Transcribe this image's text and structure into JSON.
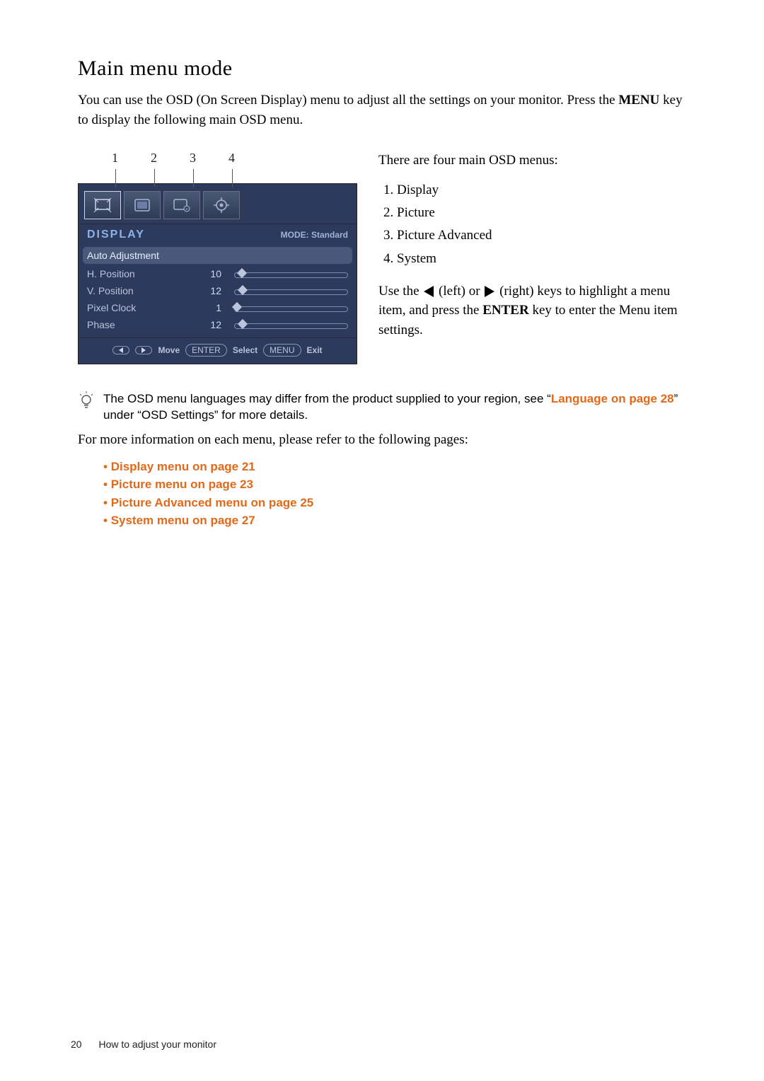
{
  "heading": "Main menu mode",
  "intro_a": "You can use the OSD (On Screen Display) menu to adjust all the settings on your monitor. Press the ",
  "intro_key": "MENU",
  "intro_b": " key to display the following main OSD menu.",
  "osd": {
    "tab_numbers": [
      "1",
      "2",
      "3",
      "4"
    ],
    "title": "DISPLAY",
    "mode_label": "MODE: Standard",
    "rows": [
      {
        "label": "Auto Adjustment",
        "value": "",
        "pct": null,
        "selected": true
      },
      {
        "label": "H. Position",
        "value": "10",
        "pct": 10,
        "selected": false
      },
      {
        "label": "V. Position",
        "value": "12",
        "pct": 12,
        "selected": false
      },
      {
        "label": "Pixel Clock",
        "value": "1",
        "pct": 1,
        "selected": false
      },
      {
        "label": "Phase",
        "value": "12",
        "pct": 12,
        "selected": false
      }
    ],
    "footer": {
      "move": "Move",
      "select": "Select",
      "enter": "ENTER",
      "menu": "MENU",
      "exit": "Exit"
    }
  },
  "right": {
    "intro": "There are four main OSD menus:",
    "menus": [
      "Display",
      "Picture",
      "Picture Advanced",
      "System"
    ],
    "use_a": "Use the ",
    "left_hint": " (left) or ",
    "right_hint": " (right) keys to high­light a menu item, and press the ",
    "enter_key": "ENTER",
    "use_b": " key to enter the Menu item settings."
  },
  "tip": {
    "text_a": "The OSD menu languages may differ from the product supplied to your region, see “",
    "link": "Language on page 28",
    "text_b": "” under “OSD Settings” for more details."
  },
  "more_info": "For more information on each menu, please refer to the following pages:",
  "bullets": [
    "Display menu on page 21",
    "Picture menu on page 23",
    "Picture Advanced menu on page 25",
    "System menu on page 27"
  ],
  "footer": {
    "page": "20",
    "section": "How to adjust your monitor"
  }
}
